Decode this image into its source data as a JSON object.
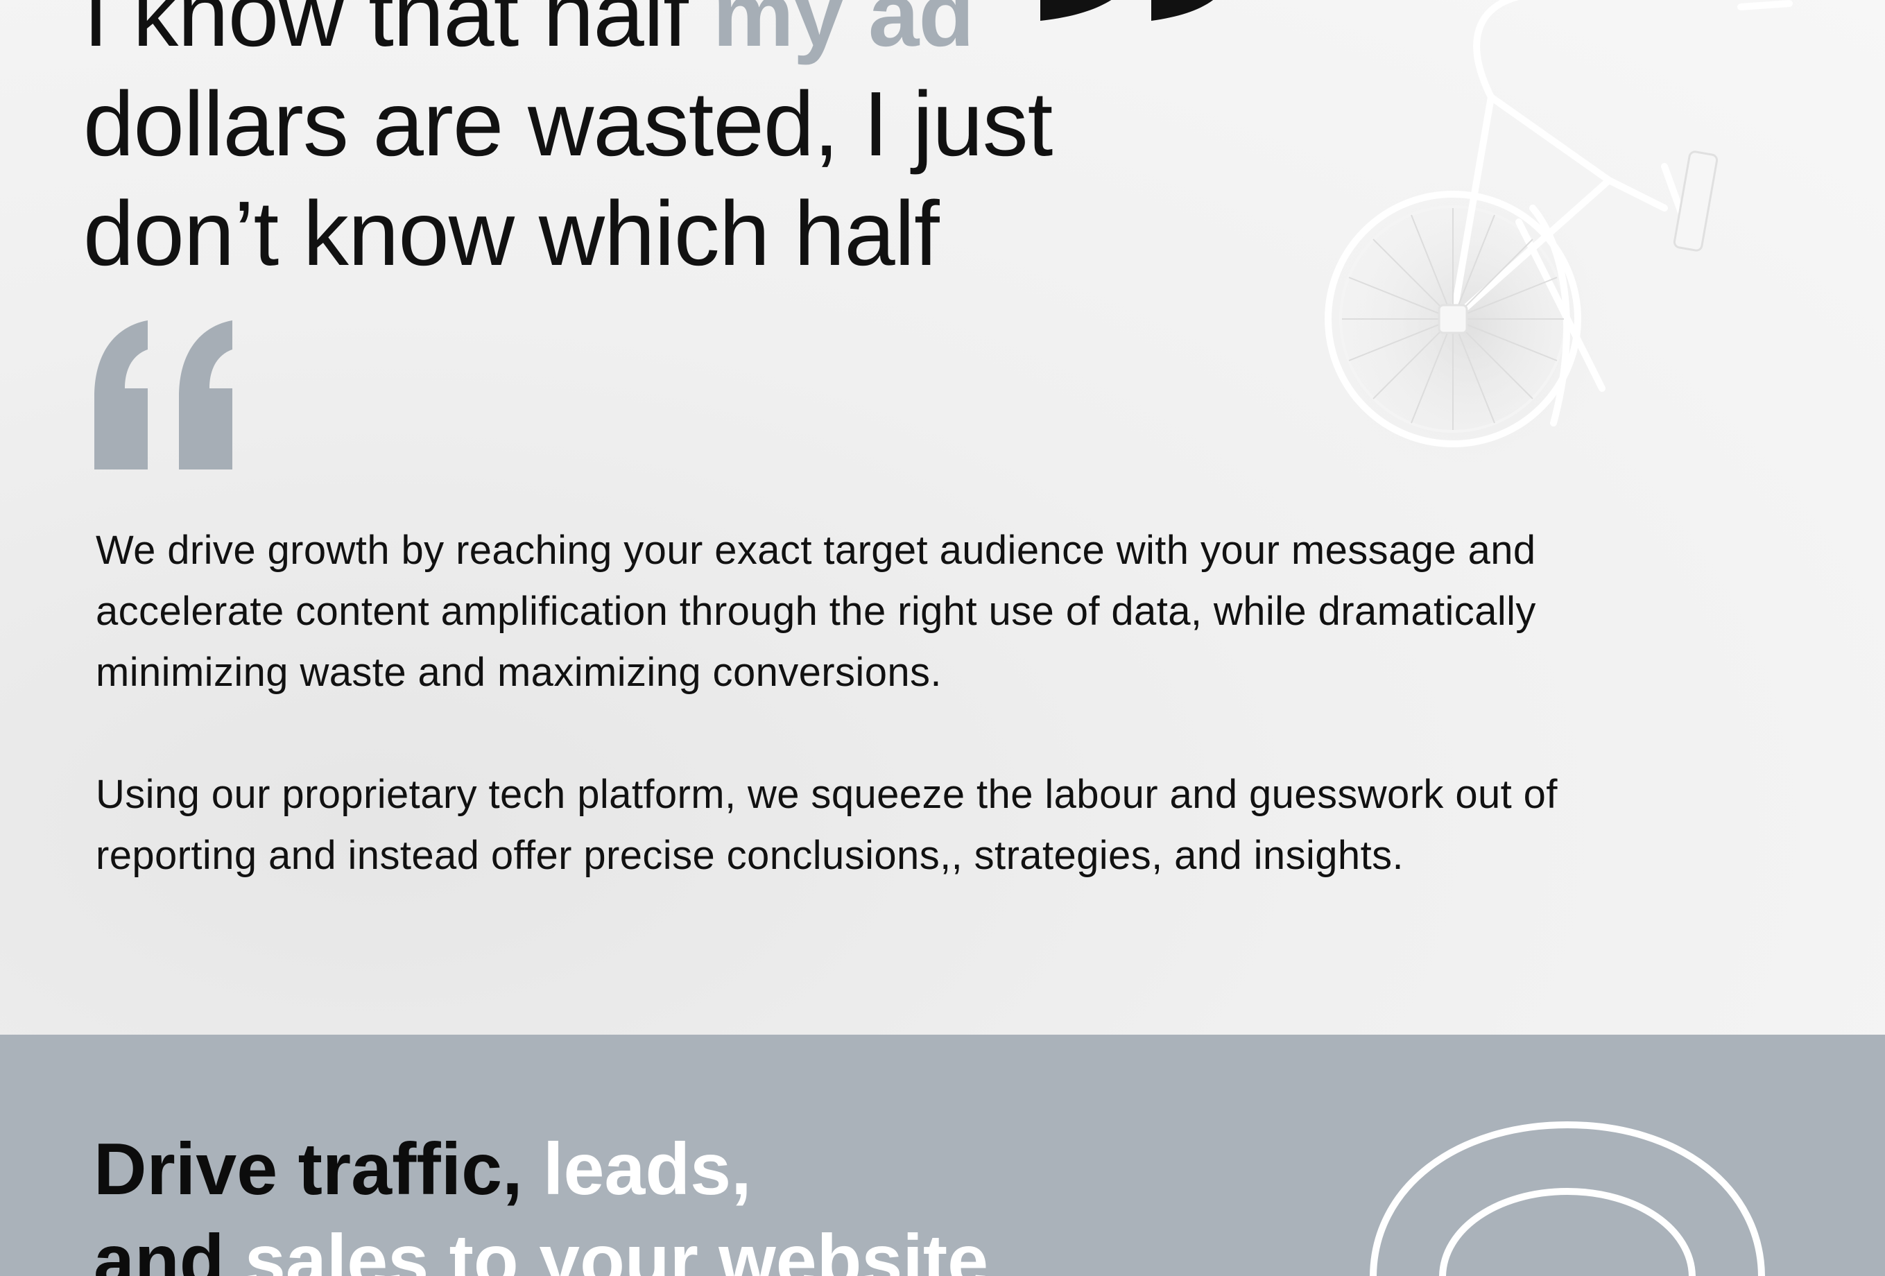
{
  "headline": {
    "part1": "I know that half ",
    "highlight": "my ad",
    "part2": "dollars are wasted, I just",
    "part3": "don’t know which half"
  },
  "colors": {
    "accent_gray": "#a6aeb6",
    "band_bg": "#aab2ba",
    "text_dark": "#111111",
    "text_white": "#ffffff"
  },
  "icons": {
    "open_quote": "quote-open-icon",
    "close_quote": "quote-close-icon",
    "bicycle": "bicycle-illustration",
    "arcs": "concentric-arcs-graphic"
  },
  "body": {
    "paragraph1": "We drive growth by reaching your exact target audience with your message and accelerate content amplification through the right use of data, while dramatically minimizing waste and maximizing conversions.",
    "paragraph2": "Using our proprietary tech platform, we squeeze the labour and guesswork  out of reporting and instead offer precise conclusions,, strategies, and insights."
  },
  "cta": {
    "line1_dark": "Drive traffic, ",
    "line1_light": "leads,",
    "line2_dark": "and ",
    "line2_light": "sales to your website"
  }
}
